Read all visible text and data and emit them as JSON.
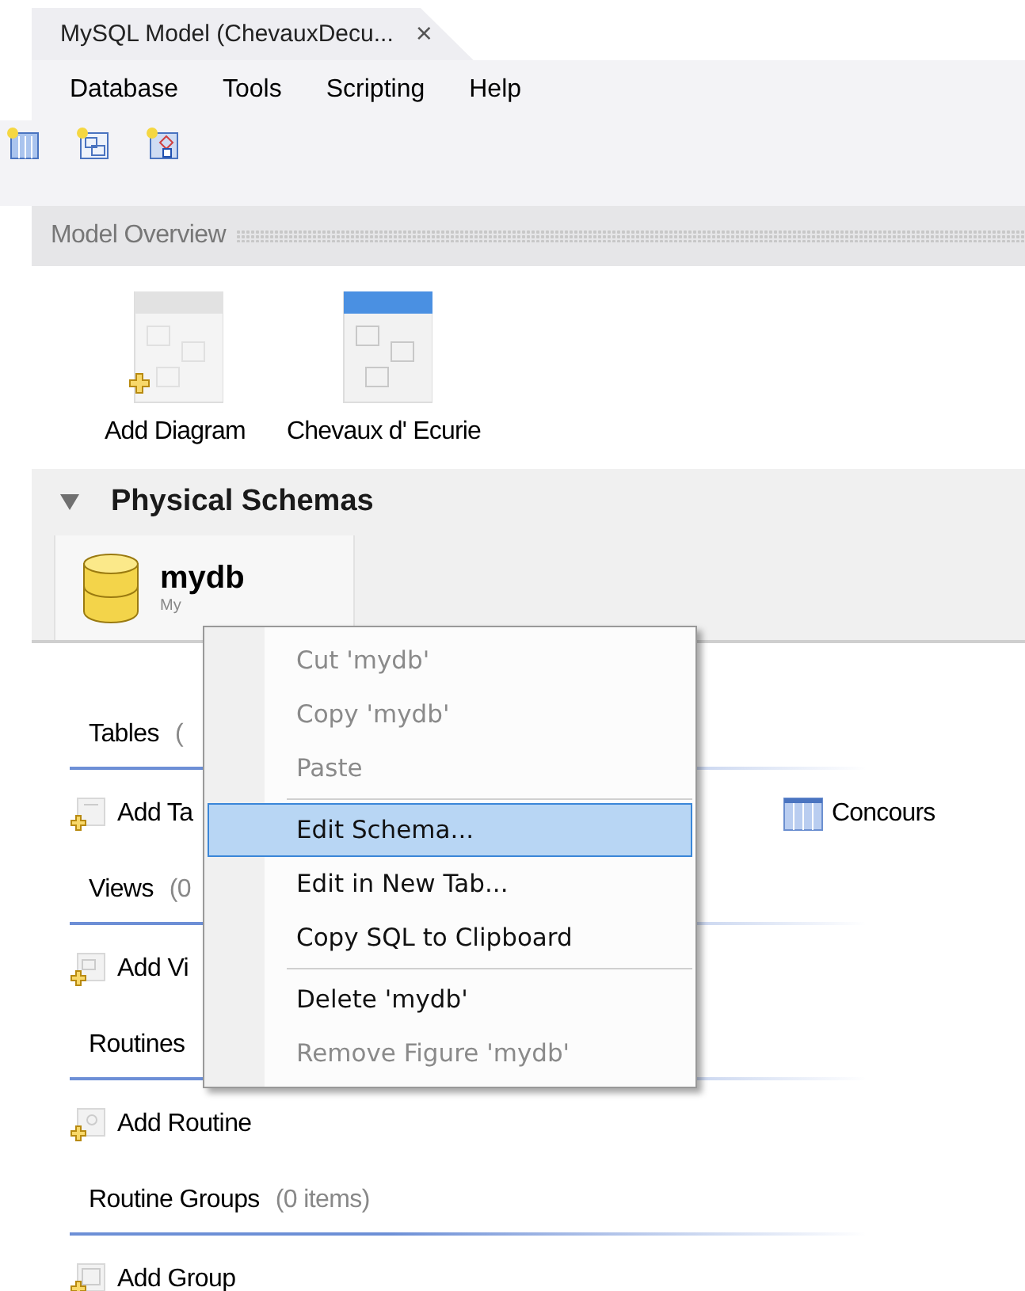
{
  "tab": {
    "title": "MySQL Model (ChevauxDecu...",
    "close": "×"
  },
  "menu_bar": [
    "Database",
    "Tools",
    "Scripting",
    "Help"
  ],
  "model_overview": {
    "title": "Model Overview",
    "diagrams": [
      {
        "label": "Add Diagram",
        "kind": "add"
      },
      {
        "label": "Chevaux d' Ecurie",
        "kind": "diagram"
      }
    ]
  },
  "physical_schemas": {
    "title": "Physical Schemas",
    "expanded": true,
    "schema": {
      "name": "mydb",
      "subtitle": "My"
    }
  },
  "sections": [
    {
      "title": "Tables",
      "count": "(",
      "items": [
        {
          "label": "Add Ta",
          "kind": "add-table"
        }
      ],
      "objects": [
        "Concours"
      ]
    },
    {
      "title": "Views",
      "count": "(0",
      "items": [
        {
          "label": "Add Vi",
          "kind": "add-view"
        }
      ]
    },
    {
      "title": "Routines",
      "items": [
        {
          "label": "Add Routine",
          "kind": "add-routine"
        }
      ]
    },
    {
      "title": "Routine Groups",
      "count": "(0 items)",
      "items": [
        {
          "label": "Add Group",
          "kind": "add-group"
        }
      ]
    }
  ],
  "context_menu": [
    {
      "kind": "item",
      "label": "Cut 'mydb'",
      "disabled": true,
      "selected": false
    },
    {
      "kind": "item",
      "label": "Copy 'mydb'",
      "disabled": true,
      "selected": false
    },
    {
      "kind": "item",
      "label": "Paste",
      "disabled": true,
      "selected": false
    },
    {
      "kind": "separator"
    },
    {
      "kind": "item",
      "label": "Edit Schema...",
      "disabled": false,
      "selected": true
    },
    {
      "kind": "item",
      "label": "Edit in New Tab...",
      "disabled": false,
      "selected": false
    },
    {
      "kind": "item",
      "label": "Copy SQL to Clipboard",
      "disabled": false,
      "selected": false
    },
    {
      "kind": "separator"
    },
    {
      "kind": "item",
      "label": "Delete 'mydb'",
      "disabled": false,
      "selected": false
    },
    {
      "kind": "item",
      "label": "Remove Figure 'mydb'",
      "disabled": true,
      "selected": false
    }
  ]
}
